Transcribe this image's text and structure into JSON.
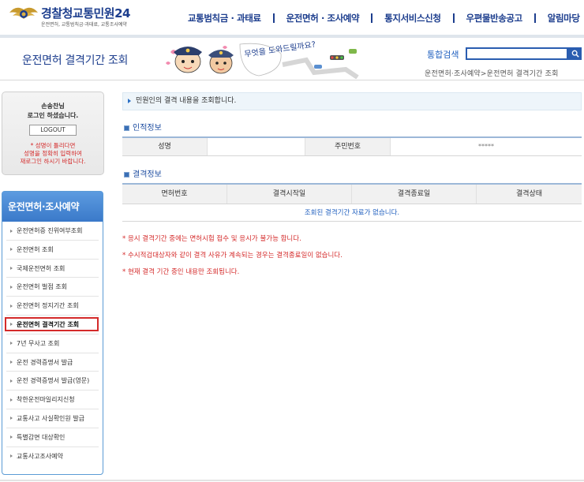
{
  "header": {
    "logo_brand_1": "경찰청",
    "logo_brand_2": "교통민원24",
    "logo_sub": "운전면허, 교통범칙금·과태료, 교통조사예약",
    "nav": [
      {
        "label": "교통범칙금 · 과태료"
      },
      {
        "label": "운전면허 · 조사예약"
      },
      {
        "label": "통지서비스신청"
      },
      {
        "label": "우편물반송공고"
      },
      {
        "label": "알림마당"
      }
    ]
  },
  "banner": {
    "page_title": "운전면허 결격기간 조회",
    "illustration_text": "무엇을 도와드릴까요?",
    "search_label": "통합검색",
    "search_value": "",
    "breadcrumb": "운전면허·조사예약>운전면허 결격기간 조회"
  },
  "login": {
    "name": "손송찬님",
    "message": "로그인 하셨습니다.",
    "logout_label": "LOGOUT",
    "warn_1": "* 성명이 틀리다면",
    "warn_2": "성명을 정확히 입력하여",
    "warn_3": "재로그인 하시기 바랍니다."
  },
  "side_menu": {
    "title": "운전면허·조사예약",
    "items": [
      {
        "label": "운전면허증 진위여부조회"
      },
      {
        "label": "운전면허 조회"
      },
      {
        "label": "국제운전면허 조회"
      },
      {
        "label": "운전면허 벌점 조회"
      },
      {
        "label": "운전면허 정지기간 조회"
      },
      {
        "label": "운전면허 결격기간 조회"
      },
      {
        "label": "7년 무사고 조회"
      },
      {
        "label": "운전 경력증명서 발급"
      },
      {
        "label": "운전 경력증명서 발급(영문)"
      },
      {
        "label": "착한운전마일리지신청"
      },
      {
        "label": "교통사고 사실확인원 발급"
      },
      {
        "label": "특별감면 대상확인"
      },
      {
        "label": "교통사고조사예약"
      }
    ]
  },
  "content": {
    "notice": "민원인의 결격 내용을 조회합니다.",
    "person_section": "인적정보",
    "person_table": {
      "name_label": "성명",
      "name_value": "",
      "id_label": "주민번호",
      "id_value": "*****"
    },
    "suspension_section": "결격정보",
    "suspension_table": {
      "headers": [
        "면허번호",
        "결격시작일",
        "결격종료일",
        "결격상태"
      ],
      "empty_message": "조회된 결격기간 자료가 없습니다."
    },
    "notes": [
      "* 응시 결격기간 중에는 면허시험 접수 및 응시가 불가능 합니다.",
      "* 수시적검대상자와 같이 결격 사유가 계속되는 경우는 결격종료일이 없습니다.",
      "* 현재 결격 기간 중인 내용만 조회됩니다."
    ]
  }
}
